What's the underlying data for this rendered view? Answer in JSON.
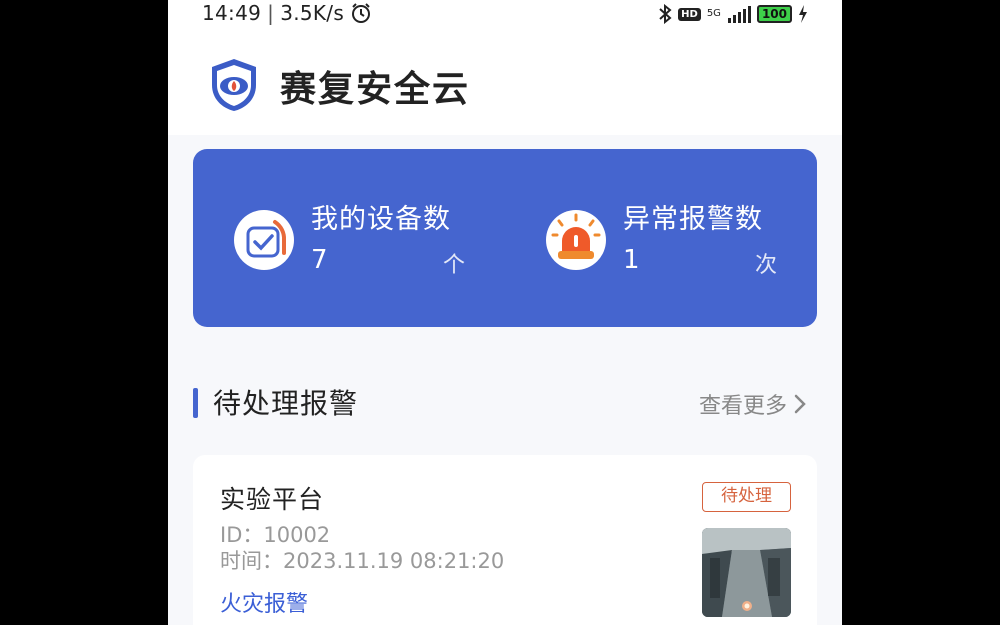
{
  "status_bar": {
    "time": "14:49",
    "separator": "|",
    "net_speed": "3.5K/s",
    "alarm_clock_icon": "alarm-clock-icon",
    "bluetooth_icon": "bluetooth-icon",
    "hd": "HD",
    "network": "5G",
    "battery": "100"
  },
  "header": {
    "logo_icon": "shield-eye-icon",
    "app_name": "赛复安全云"
  },
  "stats": {
    "devices": {
      "label": "我的设备数",
      "value": "7",
      "unit": "个",
      "icon": "device-check-icon"
    },
    "alarms": {
      "label": "异常报警数",
      "value": "1",
      "unit": "次",
      "icon": "siren-icon"
    }
  },
  "pending_section": {
    "title": "待处理报警",
    "more_label": "查看更多"
  },
  "alarm_item": {
    "name": "实验平台",
    "id_text": "ID：10002",
    "time_text": "时间：2023.11.19 08:21:20",
    "type": "火灾报警",
    "status": "待处理"
  },
  "colors": {
    "brand_blue": "#4565cf",
    "status_orange": "#d6633e",
    "link_blue": "#3b5fd6"
  }
}
